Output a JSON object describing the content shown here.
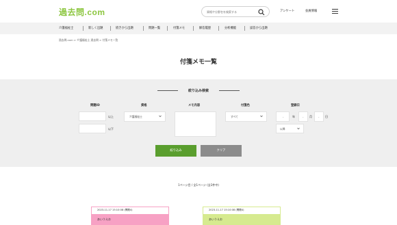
{
  "header": {
    "logo": "過去問.com",
    "search_placeholder": "資格や分野名を検索する",
    "survey_label": "アンケート",
    "member_label": "会員情報"
  },
  "nav": [
    "介護福祉士",
    "新しく出題",
    "続きから出題",
    "問題一覧",
    "付箋メモ",
    "解答履歴",
    "分析機能",
    "誤答から出題"
  ],
  "breadcrumb": "過去問.com > 介護福祉士 過去問 > 付箋メモ一覧",
  "page_title": "付箋メモ一覧",
  "filter": {
    "heading": "絞り込み検索",
    "labels": {
      "question_id": "問題ID",
      "qualification": "資格",
      "memo": "メモ内容",
      "sticky_color": "付箋色",
      "registered": "登録日"
    },
    "id_from_suffix": "以上",
    "id_to_suffix": "以下",
    "qualification_value": "介護福祉士",
    "color_value": "すべて",
    "date_dash": "-",
    "date_year": "年",
    "date_month": "月",
    "date_day": "日",
    "date_range_value": "以降",
    "submit_label": "絞り込み",
    "clear_label": "クリア"
  },
  "pagination": "1ページ目 / 全1ページ (全2件中)",
  "cards": [
    {
      "datetime": "2023-11-17 15:10:08 (問題4)",
      "text": "あいうえお",
      "color": "#f7a1c4"
    },
    {
      "datetime": "2023-11-17 15:10:08 (問題4)",
      "text": "あいうえお",
      "color": "#d6ea8f"
    }
  ],
  "colors": {
    "brand": "#8cc63f",
    "submit": "#5a9e2e",
    "clear": "#8c8c8c"
  }
}
